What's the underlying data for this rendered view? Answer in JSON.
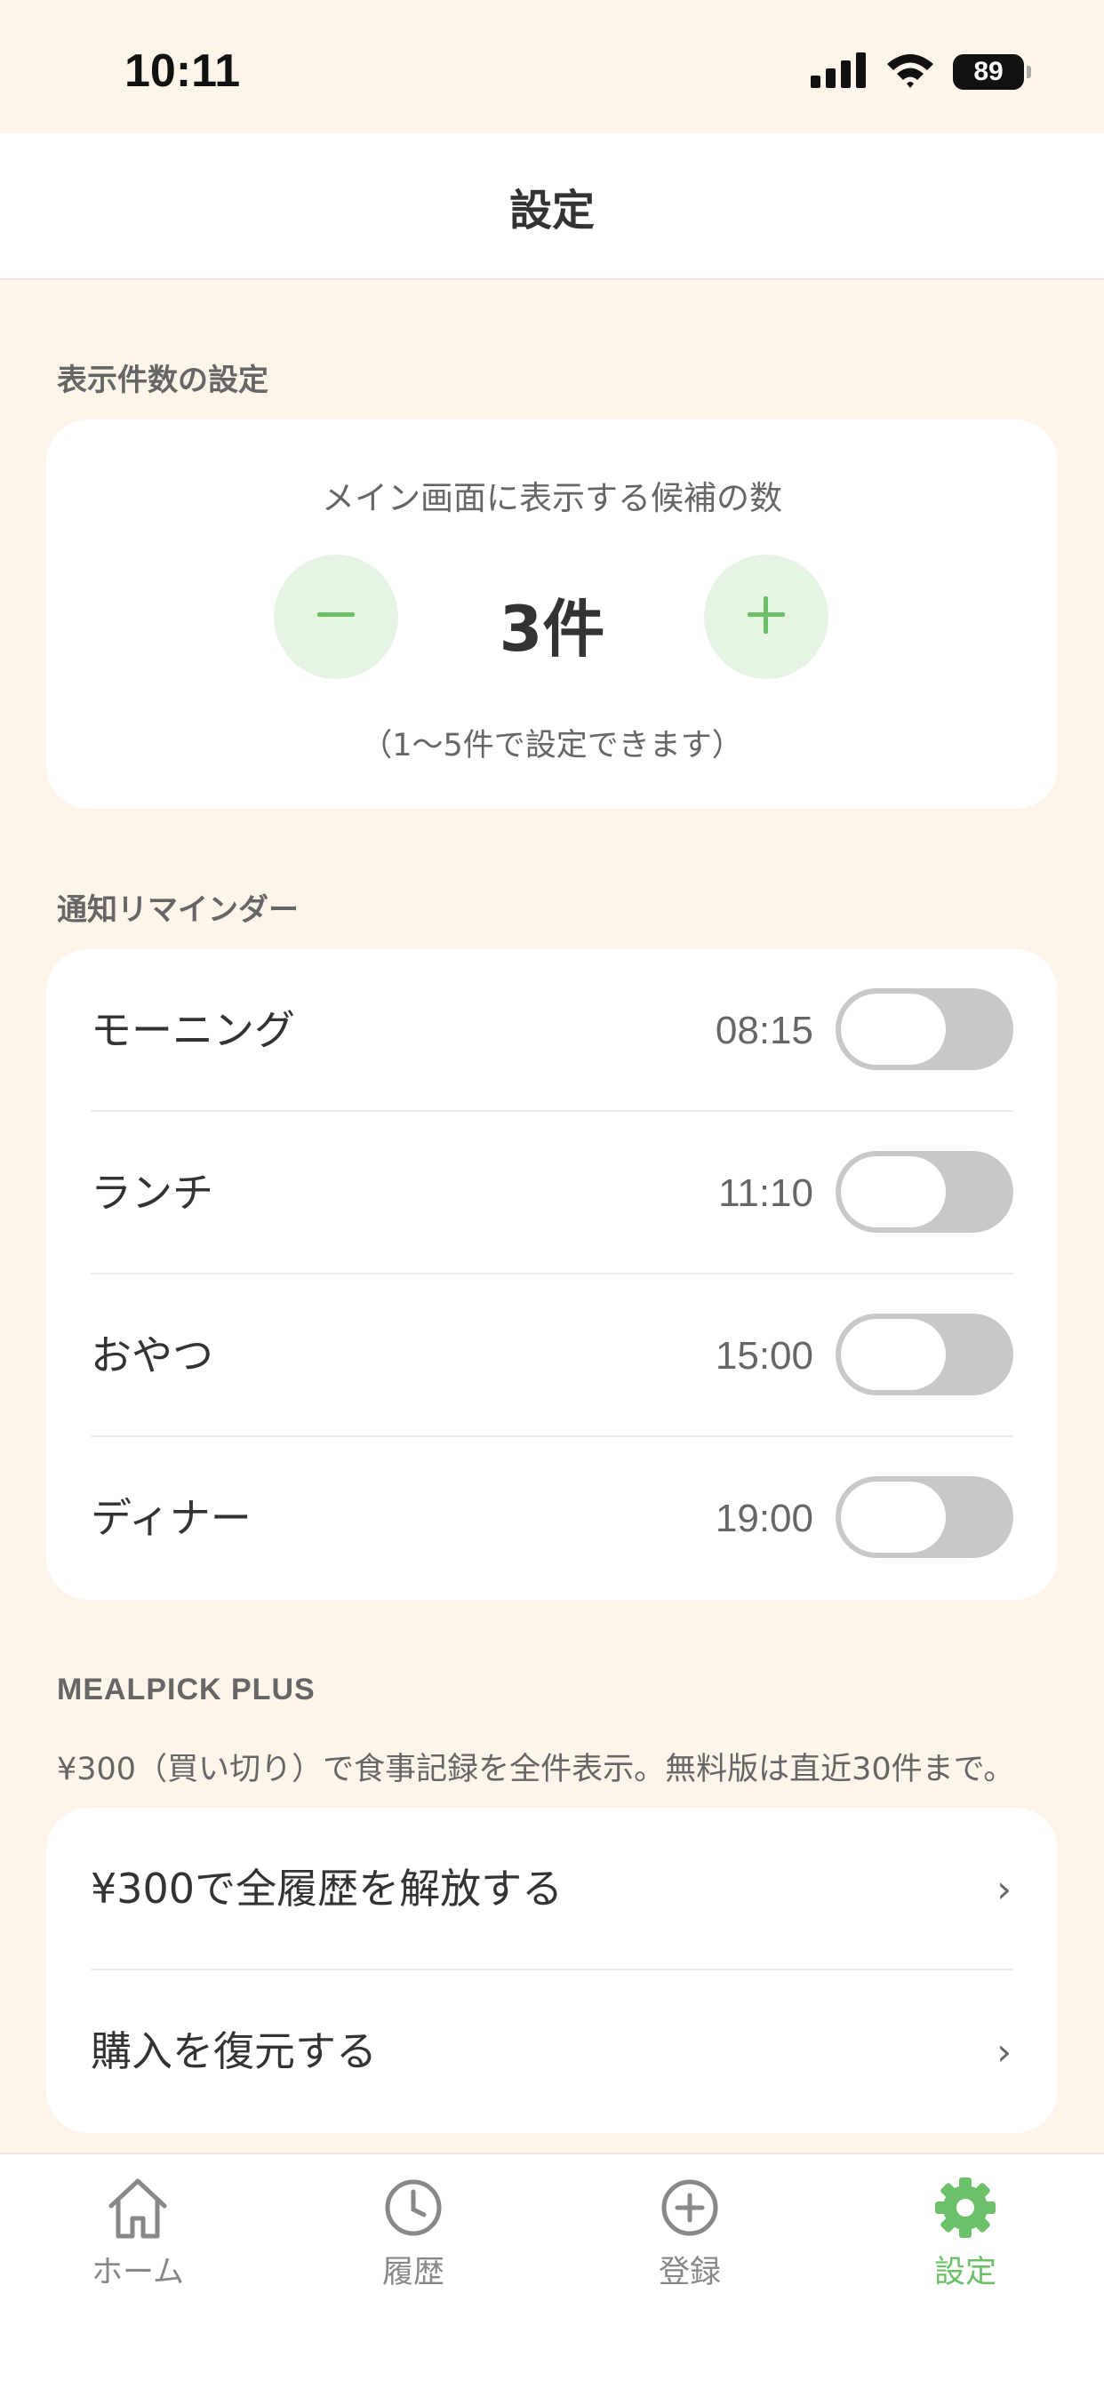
{
  "status_bar": {
    "time": "10:11",
    "battery": "89"
  },
  "header": {
    "title": "設定"
  },
  "display_count": {
    "section_label": "表示件数の設定",
    "caption": "メイン画面に表示する候補の数",
    "value": "3件",
    "hint": "（1〜5件で設定できます）",
    "minus_icon": "minus-icon",
    "plus_icon": "plus-icon"
  },
  "reminders": {
    "section_label": "通知リマインダー",
    "items": [
      {
        "label": "モーニング",
        "time": "08:15",
        "enabled": false
      },
      {
        "label": "ランチ",
        "time": "11:10",
        "enabled": false
      },
      {
        "label": "おやつ",
        "time": "15:00",
        "enabled": false
      },
      {
        "label": "ディナー",
        "time": "19:00",
        "enabled": false
      }
    ]
  },
  "plus": {
    "section_label": "MEALPICK PLUS",
    "description": "¥300（買い切り）で食事記録を全件表示。無料版は直近30件まで。",
    "items": [
      {
        "label": "¥300で全履歴を解放する",
        "chevron": "›"
      },
      {
        "label": "購入を復元する",
        "chevron": "›"
      }
    ]
  },
  "tab_bar": {
    "tabs": [
      {
        "label": "ホーム",
        "icon": "home-icon",
        "active": false
      },
      {
        "label": "履歴",
        "icon": "clock-icon",
        "active": false
      },
      {
        "label": "登録",
        "icon": "plus-circle-icon",
        "active": false
      },
      {
        "label": "設定",
        "icon": "gear-icon",
        "active": true
      }
    ]
  },
  "colors": {
    "background": "#fdf4ea",
    "accent": "#6cc06a",
    "accent_light": "#e6f4e4",
    "toggle_off": "#c8c8c8"
  }
}
